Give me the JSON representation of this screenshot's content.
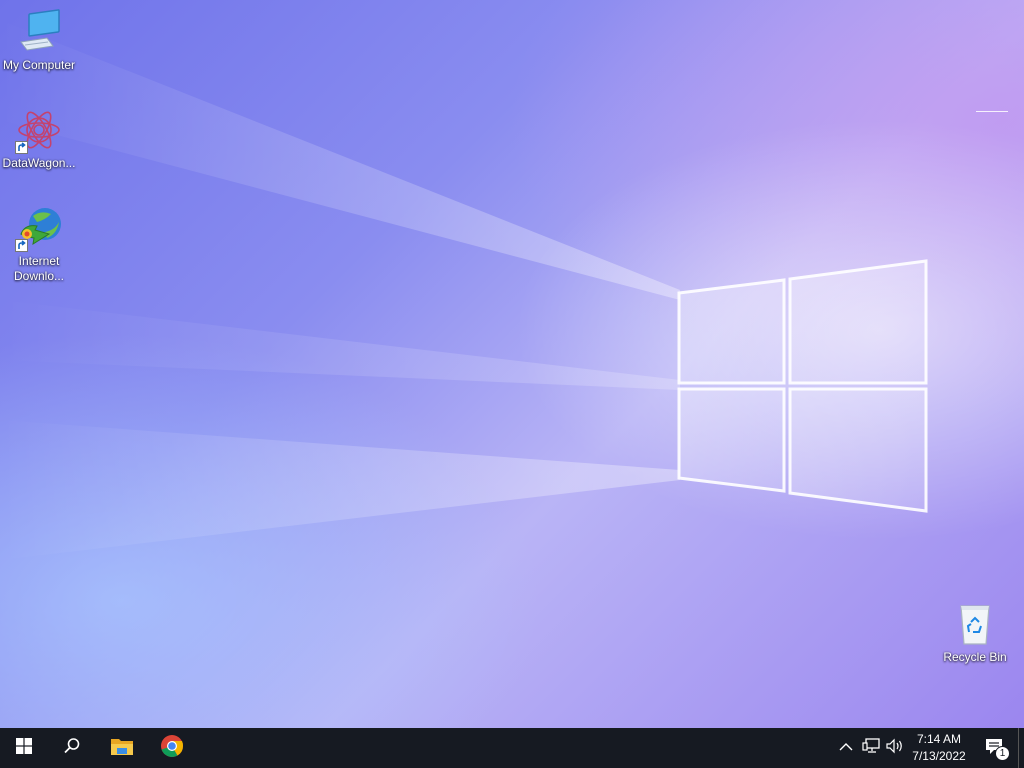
{
  "desktop": {
    "icons": [
      {
        "label": "My Computer",
        "icon": "computer-icon"
      },
      {
        "label": "DataWagon...",
        "icon": "datawagon-app-icon"
      },
      {
        "label": "Internet\nDownlo...",
        "icon": "internet-download-manager-icon"
      },
      {
        "label": "Recycle Bin",
        "icon": "recycle-bin-icon"
      }
    ]
  },
  "taskbar": {
    "buttons": [
      {
        "icon": "windows-start-icon"
      },
      {
        "icon": "search-icon"
      },
      {
        "icon": "file-explorer-icon"
      },
      {
        "icon": "chrome-icon"
      }
    ],
    "tray": {
      "icons": [
        "chevron-up-icon",
        "network-icon",
        "volume-icon"
      ],
      "time": "7:14 AM",
      "date": "7/13/2022",
      "notification_count": "1"
    }
  },
  "colors": {
    "taskbar_bg": "#161a22",
    "desktop_primary": "#6f73ea",
    "desktop_accent": "#b9b4f6"
  }
}
